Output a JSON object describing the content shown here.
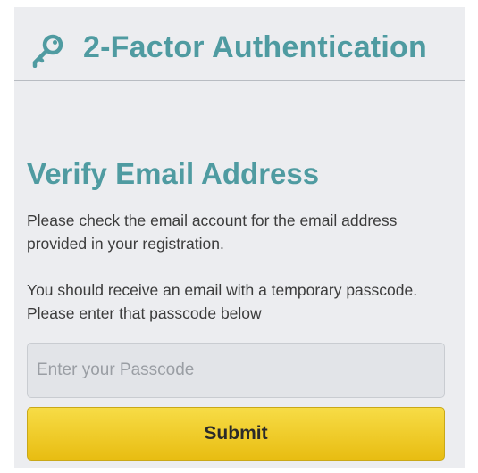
{
  "header": {
    "icon": "key-icon",
    "title": "2-Factor Authentication"
  },
  "verify": {
    "title": "Verify Email Address",
    "paragraph1": "Please check the email account for the email address provided in your registration.",
    "paragraph2": "You should receive an email with a temporary passcode. Please enter that passcode below",
    "passcode_placeholder": "Enter your Passcode",
    "passcode_value": "",
    "submit_label": "Submit"
  },
  "colors": {
    "accent": "#4f9ba1",
    "panel_background": "#ecedf0",
    "button_yellow": "#f2cc2c"
  }
}
